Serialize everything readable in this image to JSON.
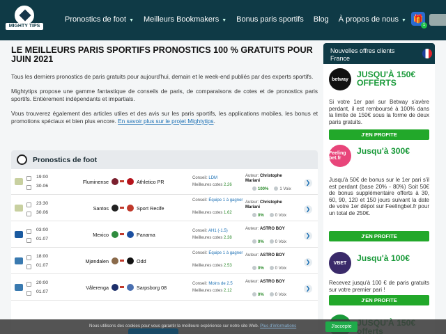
{
  "header": {
    "logo_text": "MIGHTY TIPS",
    "nav": [
      {
        "label": "Pronostics de foot",
        "caret": true
      },
      {
        "label": "Meilleurs Bookmakers",
        "caret": true
      },
      {
        "label": "Bonus paris sportifs",
        "caret": false
      },
      {
        "label": "Blog",
        "caret": false
      },
      {
        "label": "À propos de nous",
        "caret": true
      }
    ],
    "gift_count": "1"
  },
  "main": {
    "title": "LE MEILLEURS PARIS SPORTIFS PRONOSTICS 100 % GRATUITS POUR JUIN 2021",
    "p1": "Tous les derniers pronostics de paris gratuits pour aujourd'hui, demain et le week-end publiés par des experts sportifs.",
    "p2": "Mightytips propose une gamme fantastique de conseils de paris, de comparaisons de cotes et de pronostics paris sportifs. Entièrement indépendants et impartials.",
    "p3": "Vous trouverez également des articles utiles et des avis sur les paris sportifs, les applications mobiles, les bonus et promotions spéciaux et bien plus encore.",
    "p3_link": "En savoir plus sur le projet Mightytips",
    "p3_end": "."
  },
  "panel": {
    "title": "Pronostics de foot",
    "labels": {
      "conseil": "Conseil:",
      "cotes": "Meilleures cotes",
      "auteur": "Auteur:",
      "voix": "Voix"
    },
    "rows": [
      {
        "time": "19:00",
        "date": "30.06",
        "team1": "Fluminense",
        "team2": "Athletico PR",
        "tip": "LDM",
        "odds": "2.26",
        "author": "Christophe Mariani",
        "pct": "100%",
        "votes": "1",
        "c1": "#7a1f2e",
        "c2": "#b5121b",
        "comp": "#c8d0a0"
      },
      {
        "time": "23:30",
        "date": "30.06",
        "team1": "Santos",
        "team2": "Sport Recife",
        "tip": "Équipe 1 à gagner",
        "odds": "1.62",
        "author": "Christophe Mariani",
        "pct": "0%",
        "votes": "0",
        "c1": "#222222",
        "c2": "#c0392b",
        "comp": "#c8d0a0"
      },
      {
        "time": "03:00",
        "date": "01.07",
        "team1": "Mexico",
        "team2": "Panama",
        "tip": "AH1 (-1.5)",
        "odds": "2.38",
        "author": "ASTRO BOY",
        "pct": "0%",
        "votes": "0",
        "c1": "#2e8b3e",
        "c2": "#1b4fa0",
        "comp": "#1a5aa0"
      },
      {
        "time": "18:00",
        "date": "01.07",
        "team1": "Mjøndalen",
        "team2": "Odd",
        "tip": "Équipe 1 à gagner",
        "odds": "2.53",
        "author": "ASTRO BOY",
        "pct": "0%",
        "votes": "0",
        "c1": "#8a6a4a",
        "c2": "#111111",
        "comp": "#3a7ab0"
      },
      {
        "time": "20:00",
        "date": "01.07",
        "team1": "Vålerenga",
        "team2": "Sarpsborg 08",
        "tip": "Moins de 2.5",
        "odds": "2.12",
        "author": "ASTRO BOY",
        "pct": "0%",
        "votes": "0",
        "c1": "#1c2f6a",
        "c2": "#4a6fb0",
        "comp": "#3a7ab0"
      }
    ]
  },
  "sidebar": {
    "title": "Nouvelles offres clients France",
    "offers": [
      {
        "logo": "betway",
        "logo_color": "#111111",
        "headline": "JUSQU'À 150€ OFFERTS",
        "text": "Si votre 1er pari sur Betway s'avère perdant, il est remboursé à 100% dans la limite de 150€ sous la forme de deux paris gratuits.",
        "button": "J'EN PROFITE"
      },
      {
        "logo": "Feeling bet.fr",
        "logo_color": "#e8457a",
        "headline": "Jusqu'à 300€",
        "text": "Jusqu'à 50€ de bonus sur le 1er pari s'il est perdant (base 20% - 80%) Soit 50€ de bonus supplémentaire offerts à 30, 60, 90, 120 et 150 jours suivant la date de votre 1er dépot sur Feelingbet.fr pour un total de 250€.",
        "button": "J'EN PROFITE"
      },
      {
        "logo": "VBET",
        "logo_color": "#3a2a6a",
        "headline": "Jusqu'à 100€",
        "text": "Recevez jusqu'à 100 € de paris gratuits sur votre premier pari !",
        "button": "J'EN PROFITE"
      },
      {
        "logo": "",
        "logo_color": "#1a9a3a",
        "headline": "JUSQU'À 150€ offerts",
        "text": "",
        "button": ""
      }
    ]
  },
  "cookie": {
    "text": "Nous utilisons des cookies pour vous garantir la meilleure expérience sur notre site Web.",
    "link": "Plus d'informations",
    "accept": "J'accepte"
  }
}
